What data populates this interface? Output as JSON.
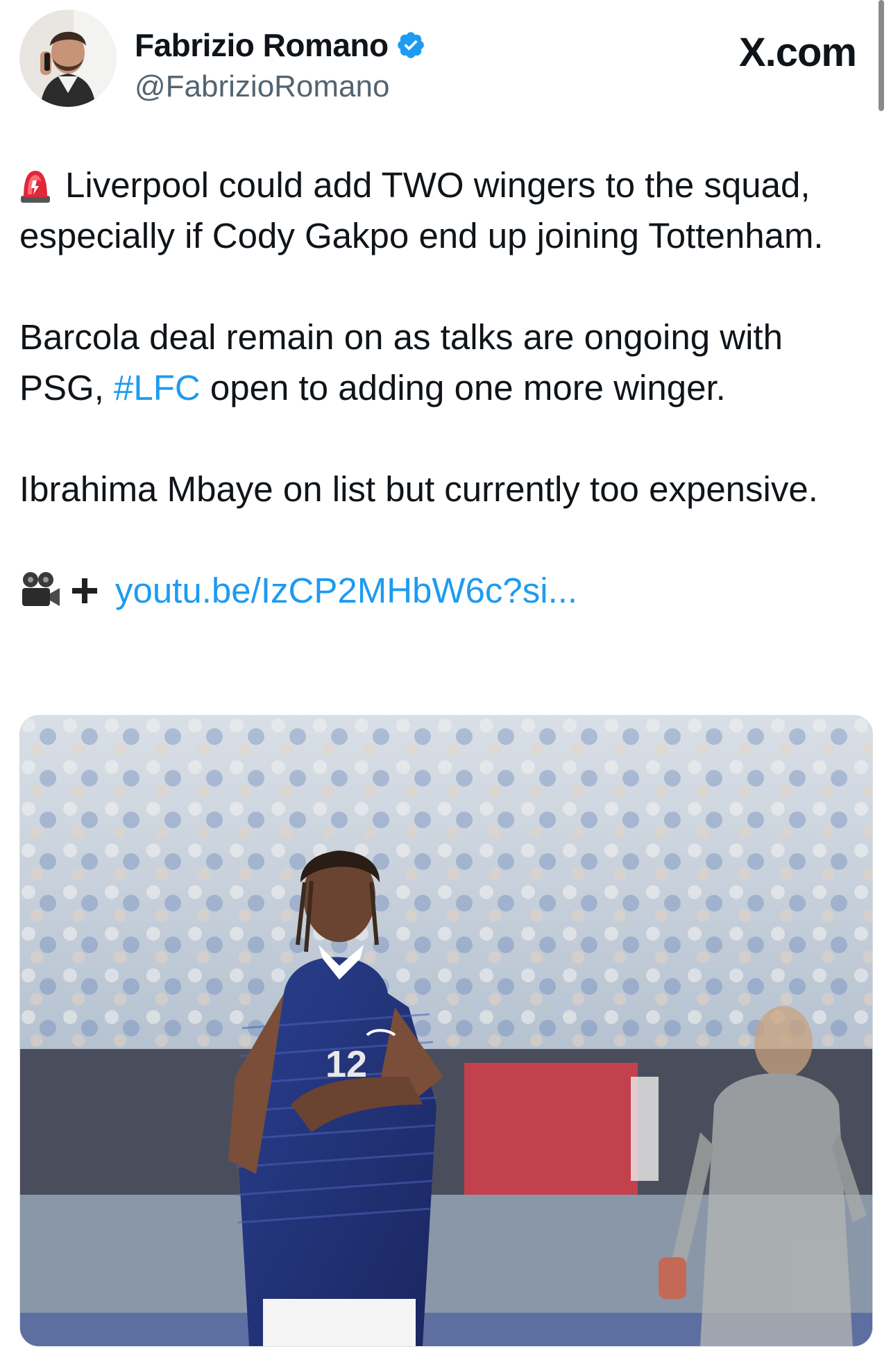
{
  "author": {
    "name": "Fabrizio Romano",
    "handle": "@FabrizioRomano",
    "verified": true
  },
  "site": "X.com",
  "tweet": {
    "paragraph1": "Liverpool could add TWO wingers to the squad, especially if Cody Gakpo end up joining Tottenham.",
    "paragraph2_start": "Barcola deal remain on as talks are ongoing with PSG, ",
    "hashtag": "#LFC",
    "paragraph2_end": " open to adding one more winger.",
    "paragraph3": "Ibrahima Mbaye on list but currently too expensive.",
    "link": "youtu.be/IzCP2MHbW6c?si..."
  },
  "icons": {
    "alert": "rotating-light-icon",
    "video": "movie-camera-icon",
    "plus": "plus-icon",
    "verified": "verified-badge-icon"
  },
  "media": {
    "jersey_number": "12",
    "alt": "Football player in blue kit gesturing with hands in stadium"
  },
  "colors": {
    "link": "#1d9bf0",
    "verified": "#1d9bf0",
    "text": "#0f1419",
    "muted": "#536471"
  }
}
